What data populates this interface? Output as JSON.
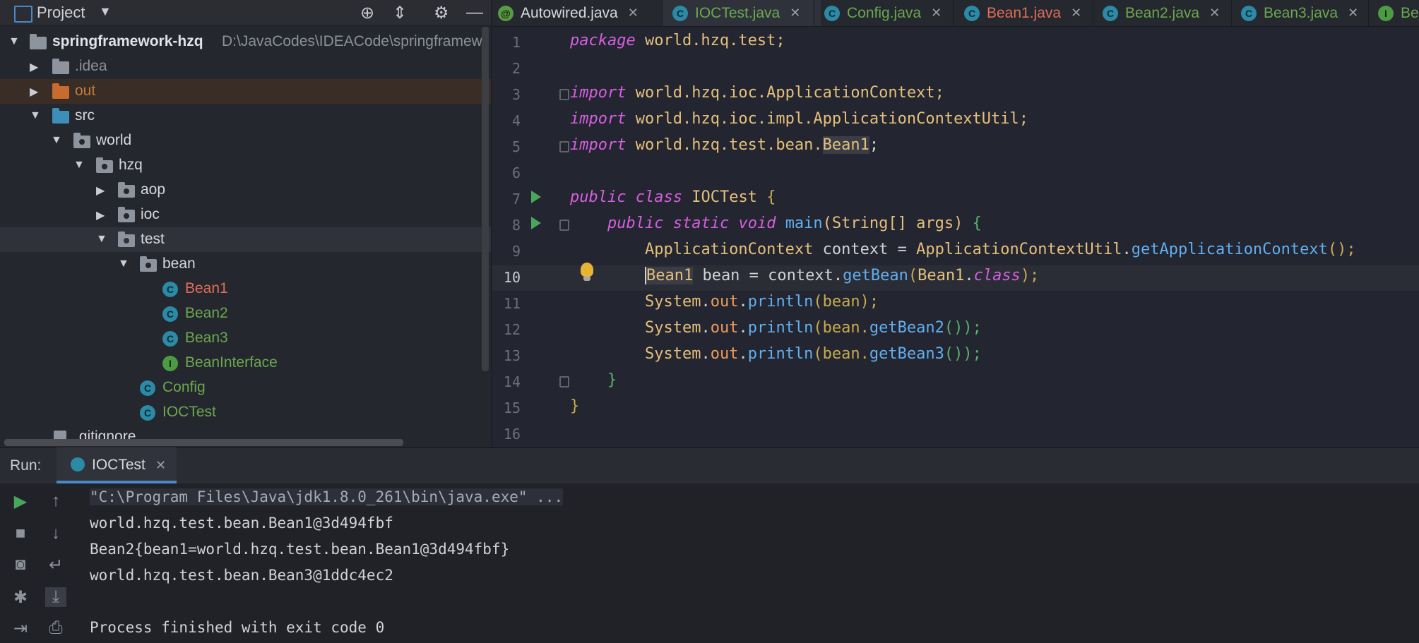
{
  "project": {
    "title": "Project",
    "root_name": "springframework-hzq",
    "root_path": "D:\\JavaCodes\\IDEACode\\springframew",
    "tree": [
      {
        "label": ".idea"
      },
      {
        "label": "out"
      },
      {
        "label": "src"
      },
      {
        "label": "world"
      },
      {
        "label": "hzq"
      },
      {
        "label": "aop"
      },
      {
        "label": "ioc"
      },
      {
        "label": "test"
      },
      {
        "label": "bean"
      },
      {
        "label": "Bean1"
      },
      {
        "label": "Bean2"
      },
      {
        "label": "Bean3"
      },
      {
        "label": "BeanInterface"
      },
      {
        "label": "Config"
      },
      {
        "label": "IOCTest"
      },
      {
        "label": ".gitignore"
      }
    ]
  },
  "tabs": [
    {
      "label": "Autowired.java",
      "icon": "@"
    },
    {
      "label": "IOCTest.java",
      "icon": "C"
    },
    {
      "label": "Config.java",
      "icon": "C"
    },
    {
      "label": "Bean1.java",
      "icon": "C"
    },
    {
      "label": "Bean2.java",
      "icon": "C"
    },
    {
      "label": "Bean3.java",
      "icon": "C"
    },
    {
      "label": "Be",
      "icon": "I"
    }
  ],
  "editor": {
    "line_numbers": [
      "1",
      "2",
      "3",
      "4",
      "5",
      "6",
      "7",
      "8",
      "9",
      "10",
      "11",
      "12",
      "13",
      "14",
      "15",
      "16"
    ],
    "current_line": "10",
    "code": {
      "l1_kw": "package",
      "l1_rest": " world.hzq.test;",
      "l3_kw": "import",
      "l3_rest": " world.hzq.ioc.ApplicationContext;",
      "l4_kw": "import",
      "l4_rest": " world.hzq.ioc.impl.ApplicationContextUtil;",
      "l5_kw": "import",
      "l5_rest": " world.hzq.test.bean.",
      "l5_cls": "Bean1",
      "l5_end": ";",
      "l7_kw1": "public",
      "l7_kw2": "class",
      "l7_name": " IOCTest ",
      "l7_br": "{",
      "l8_kw1": "public",
      "l8_kw2": "static",
      "l8_kw3": "void",
      "l8_fn": "main",
      "l8_args": "(String[] args) ",
      "l8_br": "{",
      "l9_type": "ApplicationContext",
      "l9_mid": " context = ",
      "l9_util": "ApplicationContextUtil",
      "l9_dot": ".",
      "l9_fn": "getApplicationContext",
      "l9_end": "();",
      "l10_type": "Bean1",
      "l10_mid": " bean = context.",
      "l10_fn": "getBean",
      "l10_open": "(",
      "l10_cls": "Bean1",
      "l10_dot": ".",
      "l10_kw": "class",
      "l10_end": ");",
      "l11_sys": "System",
      "l11_dot": ".",
      "l11_out": "out",
      "l11_dot2": ".",
      "l11_fn": "println",
      "l11_rest": "(bean);",
      "l12_sys": "System",
      "l12_dot": ".",
      "l12_out": "out",
      "l12_dot2": ".",
      "l12_fn": "println",
      "l12_mid": "(bean.",
      "l12_fn2": "getBean2",
      "l12_end": "());",
      "l13_sys": "System",
      "l13_dot": ".",
      "l13_out": "out",
      "l13_dot2": ".",
      "l13_fn": "println",
      "l13_mid": "(bean.",
      "l13_fn2": "getBean3",
      "l13_end": "());",
      "l14": "}",
      "l15": "}"
    }
  },
  "run": {
    "label": "Run:",
    "tab": "IOCTest",
    "output": [
      "\"C:\\Program Files\\Java\\jdk1.8.0_261\\bin\\java.exe\" ...",
      "world.hzq.test.bean.Bean1@3d494fbf",
      "Bean2{bean1=world.hzq.test.bean.Bean1@3d494fbf}",
      "world.hzq.test.bean.Bean3@1ddc4ec2",
      "",
      "Process finished with exit code 0"
    ]
  },
  "colors": {
    "accent": "#4a88c7",
    "keyword": "#d55fde",
    "type": "#e5c07b",
    "function": "#61afef",
    "error_file": "#e06c5a",
    "modified_file": "#6aa84f"
  }
}
